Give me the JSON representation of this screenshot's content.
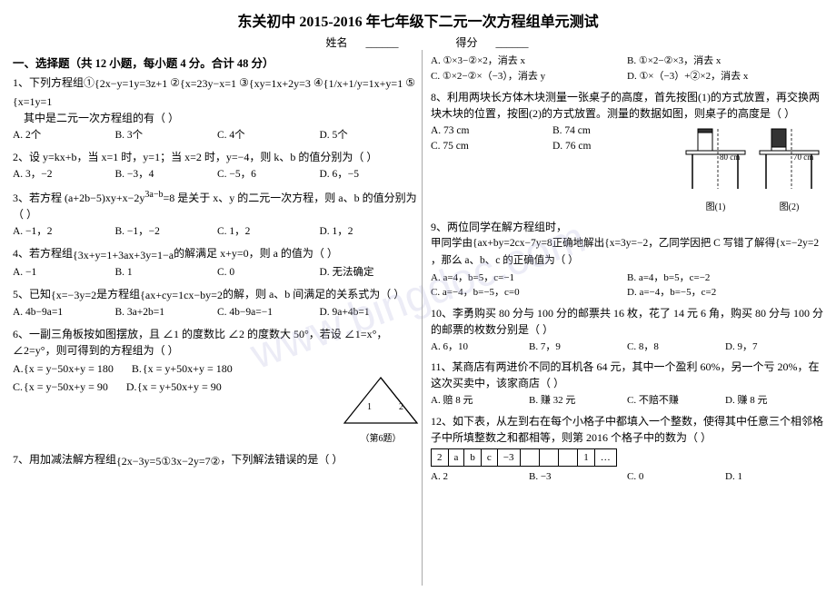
{
  "title": "东关初中 2015-2016 年七年级下二元一次方程组单元测试",
  "name_label": "姓名",
  "score_label": "得分",
  "section1_title": "一、选择题（共 12 小题，每小题 4 分。合计 48 分）",
  "q1": {
    "text": "1、下列方程组①",
    "sub": "其中是二元一次方程组的有（    ）",
    "opts": [
      "A. 2个",
      "B. 3个",
      "C. 4个",
      "D. 5个"
    ]
  },
  "q2": {
    "text": "2、设 y=kx+b，当 x=1 时，y=1；当 x=2 时，y=−4，则 k、b 的值分别为（    ）",
    "opts": [
      "A. 3，−2",
      "B. −3，4",
      "C. −5，6",
      "D. 6，−5"
    ]
  },
  "q3": {
    "text": "3、若方程 (a+2b−5)xy+x−2y^(3a−b)=8 是关于 x、y 的二元一次方程，则 a、b 的值分别为（    ）",
    "opts": [
      "A. −1，2",
      "B. −1，−2",
      "C. 1，2",
      "D. 1，2"
    ]
  },
  "q4": {
    "text": "4、若方程组",
    "sub": "的解满足 x+y=0，则 a 的值为（    ）",
    "opts": [
      "A. −1",
      "B. 1",
      "C. 0",
      "D. 无法确定"
    ]
  },
  "q5": {
    "text": "5、已知",
    "sub": "是方程组",
    "sub2": "的解，则 a、b 间满足的关系式为（    ）",
    "opts": [
      "A. 4b−9a=1",
      "B. 3a+2b=1",
      "C. 4b−9a=−1",
      "D. 9a+4b=1"
    ]
  },
  "q6": {
    "text": "6、一副三角板按如图摆放，且 ∠1 的度数比 ∠2 的度数大 50°，若设 ∠1=x°，∠2=y°，则可得到的方程组为（    ）",
    "optA": "x = y−50",
    "optA2": "x+y = 180",
    "optB": "x = y+50",
    "optB2": "x+y = 180",
    "optC": "x = y−50",
    "optC2": "x+y = 90",
    "optD": "x = y+50",
    "optD2": "x+y = 90"
  },
  "q7": {
    "text": "7、用加减法解方程组",
    "sub": "，下列解法错误的是（    ）",
    "sys1": "2x−3y=5①",
    "sys2": "3x−2y=7②",
    "optA": "①×3−②×2，消去 x",
    "optB": "①×2−②×3，消去 x",
    "optC": "①×2−②×（−3），消去 y",
    "optD": "①×（−3）+②×2，消去 x"
  },
  "q8": {
    "text": "8、利用两块长方体木块测量一张桌子的高度，首先按图(1)的方式放置，再交换两块木块的位置，按图(2)的方式放置。测量的数据如图，则桌子的高度是（    ）",
    "opts": [
      "A. 73 cm",
      "B. 74 cm",
      "C. 75 cm",
      "D. 76 cm"
    ],
    "fig1_label": "图(1)",
    "fig2_label": "图(2)",
    "dim1": "80 cm",
    "dim2": "70 cm"
  },
  "q9": {
    "text": "9、两位同学在解方程组时，",
    "jia": "甲同学由",
    "jia_sys1": "ax+by=2",
    "jia_sys2": "cx−7y=8",
    "jia_result": "正确地解出",
    "jia_sol1": "x=3",
    "jia_sol2": "y=−2",
    "yi": "，乙同学因把 C 写错了解得",
    "yi_sol1": "x=−2",
    "yi_sol2": "y=2",
    "yi_sub": "，那么 a、b、c 的正确值为（    ）",
    "opts": [
      "A. a=4，b=5，c=−1",
      "B. a=4，b=5，c=−2",
      "C. a=−4，b=−5，c=0",
      "D. a=−4，b=−5，c=2"
    ]
  },
  "q10": {
    "text": "10、李勇购买 80 分与 100 分的邮票共 16 枚，花了 14 元 6 角，购买 80 分与 100 分的邮票的枚数分别是（    ）",
    "opts": [
      "A. 6，10",
      "B. 7，9",
      "C. 8，8",
      "D. 9，7"
    ]
  },
  "q11": {
    "text": "11、某商店有两进价不同的耳机各 64 元，其中一个盈利 60%，另一个亏 20%，在这次买卖中，该家商店（    ）",
    "opts": [
      "A. 赔 8 元",
      "B. 赚 32 元",
      "C. 不赔不赚",
      "D. 赚 8 元"
    ]
  },
  "q12": {
    "text": "12、如下表，从左到右在每个小格子中都填入一个整数，使得其中任意三个相邻格子中所填整数之和都相等，则第 2016 个格子中的数为（    ）",
    "table": [
      "2",
      "a",
      "b",
      "c",
      "−3",
      "",
      "",
      "",
      "1",
      "…"
    ],
    "opts": [
      "A. 2",
      "B. −3",
      "C. 0",
      "D. 1"
    ]
  }
}
